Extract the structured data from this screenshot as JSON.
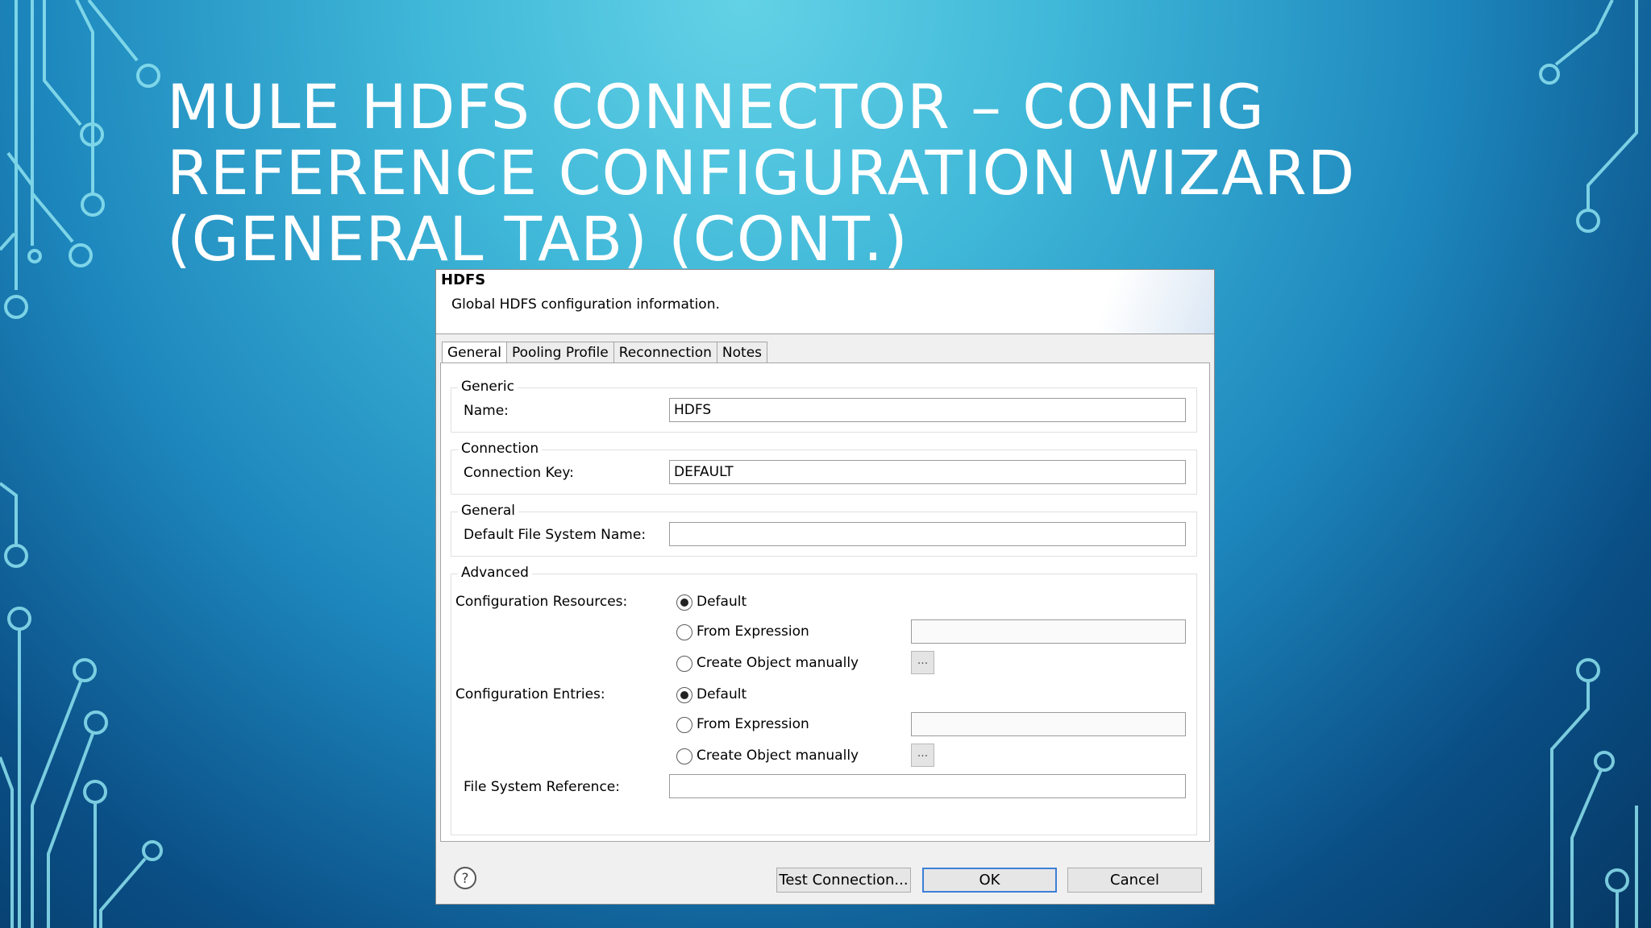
{
  "slide": {
    "title_lines": [
      "MULE HDFS CONNECTOR – CONFIG",
      "REFERENCE CONFIGURATION WIZARD",
      "(GENERAL TAB) (CONT.)"
    ]
  },
  "dialog": {
    "title": "HDFS",
    "description": "Global HDFS configuration information.",
    "tabs": [
      {
        "label": "General",
        "active": true
      },
      {
        "label": "Pooling Profile",
        "active": false
      },
      {
        "label": "Reconnection",
        "active": false
      },
      {
        "label": "Notes",
        "active": false
      }
    ],
    "groups": {
      "generic": {
        "legend": "Generic",
        "name_label": "Name:",
        "name_value": "HDFS"
      },
      "connection": {
        "legend": "Connection",
        "key_label": "Connection Key:",
        "key_value": "DEFAULT"
      },
      "general": {
        "legend": "General",
        "fs_name_label": "Default File System Name:",
        "fs_name_value": ""
      },
      "advanced": {
        "legend": "Advanced",
        "config_resources": {
          "label": "Configuration Resources:",
          "options": [
            "Default",
            "From Expression",
            "Create Object manually"
          ],
          "selected": "Default",
          "expression_value": "",
          "ellipsis": "..."
        },
        "config_entries": {
          "label": "Configuration Entries:",
          "options": [
            "Default",
            "From Expression",
            "Create Object manually"
          ],
          "selected": "Default",
          "expression_value": "",
          "ellipsis": "..."
        },
        "fs_reference_label": "File System Reference:",
        "fs_reference_value": ""
      }
    },
    "buttons": {
      "help_icon": "?",
      "test_connection": "Test Connection...",
      "ok": "OK",
      "cancel": "Cancel"
    }
  }
}
